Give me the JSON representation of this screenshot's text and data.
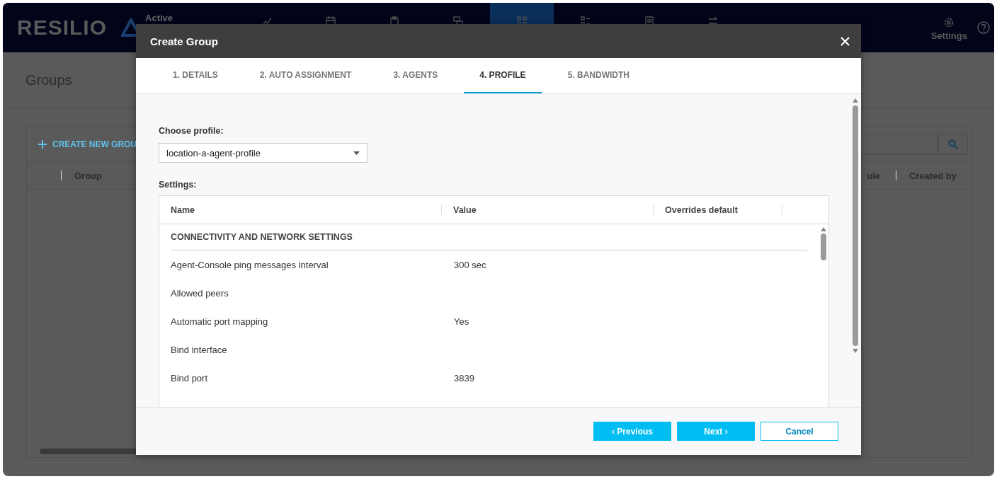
{
  "app": {
    "logo": "RESILIO",
    "product": "Active",
    "nav": [
      {
        "selected": false
      },
      {
        "selected": false
      },
      {
        "selected": false
      },
      {
        "selected": false
      },
      {
        "selected": true
      },
      {
        "selected": false
      },
      {
        "selected": false
      },
      {
        "selected": false
      }
    ],
    "settings_label": "Settings"
  },
  "page": {
    "title": "Groups",
    "create_button": "CREATE NEW GROU",
    "columns": [
      "Group",
      "ule",
      "Created by"
    ]
  },
  "dialog": {
    "title": "Create Group",
    "tabs": [
      {
        "label": "1. DETAILS",
        "selected": false
      },
      {
        "label": "2. AUTO ASSIGNMENT",
        "selected": false
      },
      {
        "label": "3. AGENTS",
        "selected": false
      },
      {
        "label": "4. PROFILE",
        "selected": true
      },
      {
        "label": "5. BANDWIDTH",
        "selected": false
      }
    ],
    "profile_label": "Choose profile:",
    "profile_value": "location-a-agent-profile",
    "settings_label": "Settings:",
    "settings_table": {
      "columns": [
        "Name",
        "Value",
        "Overrides default"
      ],
      "section": "CONNECTIVITY AND NETWORK SETTINGS",
      "rows": [
        {
          "name": "Agent-Console ping messages interval",
          "value": "300 sec"
        },
        {
          "name": "Allowed peers",
          "value": ""
        },
        {
          "name": "Automatic port mapping",
          "value": "Yes"
        },
        {
          "name": "Bind interface",
          "value": ""
        },
        {
          "name": "Bind port",
          "value": "3839"
        }
      ]
    },
    "buttons": {
      "previous": "‹ Previous",
      "next": "Next ›",
      "cancel": "Cancel"
    }
  }
}
